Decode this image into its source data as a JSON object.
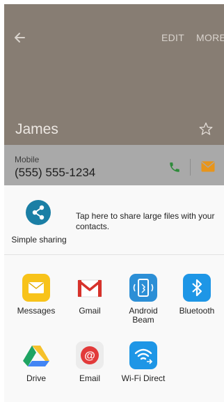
{
  "contact": {
    "name": "James",
    "edit_label": "EDIT",
    "more_label": "MORE",
    "phone_label": "Mobile",
    "phone_number": "(555) 555-1234"
  },
  "share": {
    "simple_sharing_label": "Simple sharing",
    "simple_sharing_desc": "Tap here to share large files with your contacts.",
    "apps": [
      {
        "label": "Messages",
        "icon": "messages-icon"
      },
      {
        "label": "Gmail",
        "icon": "gmail-icon"
      },
      {
        "label": "Android\nBeam",
        "icon": "android-beam-icon"
      },
      {
        "label": "Bluetooth",
        "icon": "bluetooth-icon"
      },
      {
        "label": "Drive",
        "icon": "drive-icon"
      },
      {
        "label": "Email",
        "icon": "email-icon"
      },
      {
        "label": "Wi-Fi Direct",
        "icon": "wifi-direct-icon"
      }
    ]
  },
  "colors": {
    "header_bg": "#877d73",
    "phone_row_bg": "#a9a9a9",
    "call_green": "#2e8b3a",
    "message_orange": "#e8951b",
    "simple_sharing_blue": "#1b7fa5"
  }
}
